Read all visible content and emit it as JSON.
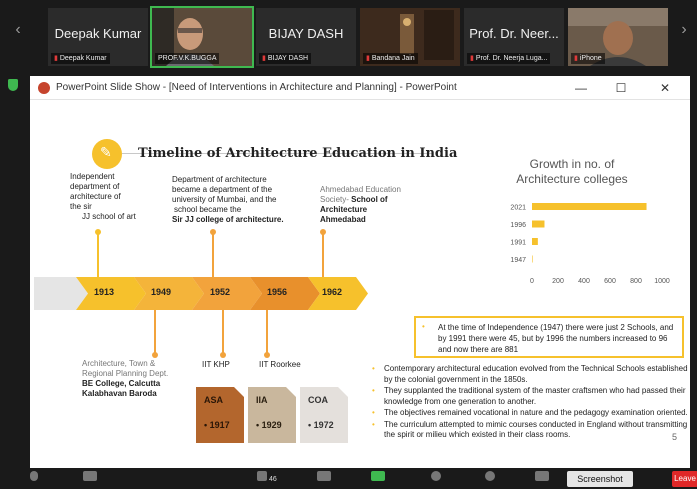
{
  "participants": [
    {
      "big": "Deepak Kumar",
      "small": "Deepak Kumar",
      "video": false
    },
    {
      "big": "",
      "small": "PROF.V.K.BUGGA",
      "video": true
    },
    {
      "big": "BIJAY DASH",
      "small": "BIJAY DASH",
      "video": false
    },
    {
      "big": "",
      "small": "Bandana Jain",
      "video": true
    },
    {
      "big": "Prof. Dr. Neer...",
      "small": "Prof. Dr. Neerja Luga...",
      "video": false
    },
    {
      "big": "",
      "small": "iPhone",
      "video": true
    }
  ],
  "window": {
    "title": "PowerPoint Slide Show - [Need of Interventions in Architecture and Planning] - PowerPoint",
    "min": "—",
    "max": "☐",
    "close": "✕"
  },
  "slide": {
    "title": "Timeline of Architecture Education in India",
    "icon": "✎",
    "top_labels": {
      "a": [
        "Independent",
        "department of",
        "architecture of",
        "the sir",
        "JJ school of art"
      ],
      "b": [
        "Department of architecture",
        "became a department of the",
        "university of Mumbai, and the",
        "school became the"
      ],
      "b_bold": "Sir JJ college of architecture.",
      "c_grey": [
        "Ahmedabad Education",
        "Society- "
      ],
      "c_bold1": "School of",
      "c_bold": [
        "Architecture",
        "Ahmedabad"
      ]
    },
    "years": [
      "1913",
      "1949",
      "1952",
      "1956",
      "1962"
    ],
    "bottom_labels": {
      "a_grey": [
        "Architecture, Town &",
        "Regional Planning Dept."
      ],
      "a_bold": [
        "BE College, Calcutta",
        "Kalabhavan Baroda"
      ],
      "b": "IIT KHP",
      "c": "IIT Roorkee"
    },
    "tiles": [
      {
        "label": "ASA",
        "year": "• 1917",
        "bg": "#b3662d",
        "fg": "#2a1607"
      },
      {
        "label": "IIA",
        "year": "• 1929",
        "bg": "#c9b79d",
        "fg": "#2a1f10"
      },
      {
        "label": "COA",
        "year": "• 1972",
        "bg": "#e4e0dc",
        "fg": "#333333"
      }
    ],
    "callout": "At the time of Independence (1947) there were just 2 Schools, and by 1991 there were 45, but by 1996 the numbers increased to 96 and now there are 881",
    "points": [
      "Contemporary architectural education evolved from the Technical Schools established by the colonial government in the 1850s.",
      "They supplanted the traditional system of the master craftsmen who had passed their knowledge from one generation to another.",
      "The objectives remained vocational in nature and the pedagogy examination oriented.",
      "The curriculum attempted to mimic courses conducted in England without transmitting the spirit or milieu which existed in their class rooms."
    ],
    "page": "5"
  },
  "chart_data": {
    "type": "bar",
    "orientation": "horizontal",
    "title": "Growth in no. of Architecture colleges",
    "categories": [
      "2021",
      "1996",
      "1991",
      "1947"
    ],
    "values": [
      881,
      96,
      45,
      2
    ],
    "xlim": [
      0,
      1000
    ],
    "xticks": [
      "0",
      "200",
      "400",
      "600",
      "800",
      "1000"
    ],
    "color": "#f6c12c",
    "grid": false
  },
  "toolbar": {
    "participants_count": "46",
    "screenshot": "Screenshot",
    "leave": "Leave"
  },
  "colors": {
    "accent": "#f6c12c",
    "orange": "#e8902c",
    "zoom_bg": "#1a1a1a",
    "leave": "#e02828"
  }
}
